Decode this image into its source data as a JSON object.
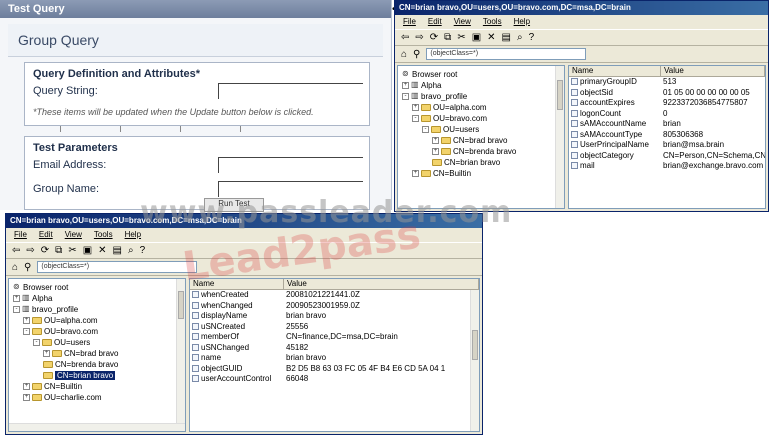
{
  "test_query": {
    "title": "Test Query",
    "group_title": "Group Query",
    "definition_heading": "Query Definition and Attributes*",
    "query_string_label": "Query String:",
    "note": "*These items will be updated when the Update button below is clicked.",
    "params_heading": "Test Parameters",
    "email_label": "Email Address:",
    "group_label": "Group Name:",
    "run_button": "Run Test"
  },
  "back_window": {
    "title": "CN=brian bravo,OU=users,OU=bravo.com,DC=msa,DC=brain",
    "menu": [
      "File",
      "Edit",
      "View",
      "Tools",
      "Help"
    ],
    "toolbar_icons": [
      "back-icon",
      "forward-icon",
      "refresh-icon",
      "copy-icon",
      "cut-icon",
      "paste-icon",
      "delete-icon",
      "properties-icon",
      "help-icon"
    ],
    "filter": "(objectClass=*)",
    "tree": [
      {
        "label": "Browser root",
        "level": 0,
        "expander": "",
        "icon": "root"
      },
      {
        "label": "Alpha",
        "level": 0,
        "expander": "+",
        "icon": "domain"
      },
      {
        "label": "bravo_profile",
        "level": 0,
        "expander": "-",
        "icon": "domain"
      },
      {
        "label": "OU=alpha.com",
        "level": 1,
        "expander": "+",
        "icon": "folder"
      },
      {
        "label": "OU=bravo.com",
        "level": 1,
        "expander": "-",
        "icon": "folder"
      },
      {
        "label": "OU=users",
        "level": 2,
        "expander": "-",
        "icon": "folder"
      },
      {
        "label": "CN=brad bravo",
        "level": 3,
        "expander": "+",
        "icon": "folder"
      },
      {
        "label": "CN=brenda bravo",
        "level": 3,
        "expander": "+",
        "icon": "folder"
      },
      {
        "label": "CN=brian bravo",
        "level": 3,
        "expander": "",
        "icon": "folder"
      },
      {
        "label": "CN=Builtin",
        "level": 1,
        "expander": "+",
        "icon": "folder"
      }
    ],
    "columns": [
      "Name",
      "Value"
    ],
    "rows": [
      {
        "name": "primaryGroupID",
        "value": "513"
      },
      {
        "name": "objectSid",
        "value": "01 05 00 00 00 00 00 05"
      },
      {
        "name": "accountExpires",
        "value": "9223372036854775807"
      },
      {
        "name": "logonCount",
        "value": "0"
      },
      {
        "name": "sAMAccountName",
        "value": "brian"
      },
      {
        "name": "sAMAccountType",
        "value": "805306368"
      },
      {
        "name": "UserPrincipalName",
        "value": "brian@msa.brain"
      },
      {
        "name": "objectCategory",
        "value": "CN=Person,CN=Schema,CN="
      },
      {
        "name": "mail",
        "value": "brian@exchange.bravo.com"
      }
    ]
  },
  "front_window": {
    "title": "CN=brian bravo,OU=users,OU=bravo.com,DC=msa,DC=brain",
    "menu": [
      "File",
      "Edit",
      "View",
      "Tools",
      "Help"
    ],
    "filter": "(objectClass=*)",
    "tree": [
      {
        "label": "Browser root",
        "level": 0,
        "expander": "",
        "icon": "root"
      },
      {
        "label": "Alpha",
        "level": 0,
        "expander": "+",
        "icon": "domain"
      },
      {
        "label": "bravo_profile",
        "level": 0,
        "expander": "-",
        "icon": "domain"
      },
      {
        "label": "OU=alpha.com",
        "level": 1,
        "expander": "+",
        "icon": "folder"
      },
      {
        "label": "OU=bravo.com",
        "level": 1,
        "expander": "-",
        "icon": "folder"
      },
      {
        "label": "OU=users",
        "level": 2,
        "expander": "-",
        "icon": "folder"
      },
      {
        "label": "CN=brad bravo",
        "level": 3,
        "expander": "+",
        "icon": "folder"
      },
      {
        "label": "CN=brenda bravo",
        "level": 3,
        "expander": "",
        "icon": "folder"
      },
      {
        "label": "CN=brian bravo",
        "level": 3,
        "expander": "",
        "icon": "folder",
        "selected": true
      },
      {
        "label": "CN=Builtin",
        "level": 1,
        "expander": "+",
        "icon": "folder"
      },
      {
        "label": "OU=charlie.com",
        "level": 1,
        "expander": "+",
        "icon": "folder"
      }
    ],
    "columns": [
      "Name",
      "Value"
    ],
    "rows": [
      {
        "name": "whenCreated",
        "value": "20081021221441.0Z"
      },
      {
        "name": "whenChanged",
        "value": "20090523001959.0Z"
      },
      {
        "name": "displayName",
        "value": "brian bravo"
      },
      {
        "name": "uSNCreated",
        "value": "25556"
      },
      {
        "name": "memberOf",
        "value": "CN=finance,DC=msa,DC=brain"
      },
      {
        "name": "uSNChanged",
        "value": "45182"
      },
      {
        "name": "name",
        "value": "brian bravo"
      },
      {
        "name": "objectGUID",
        "value": "B2 D5 B8 63 03 FC 05 4F B4 E6 CD 5A 04 1"
      },
      {
        "name": "userAccountControl",
        "value": "66048"
      }
    ]
  },
  "watermarks": {
    "site": "www.passleader.com",
    "brand": "Lead2pass"
  }
}
